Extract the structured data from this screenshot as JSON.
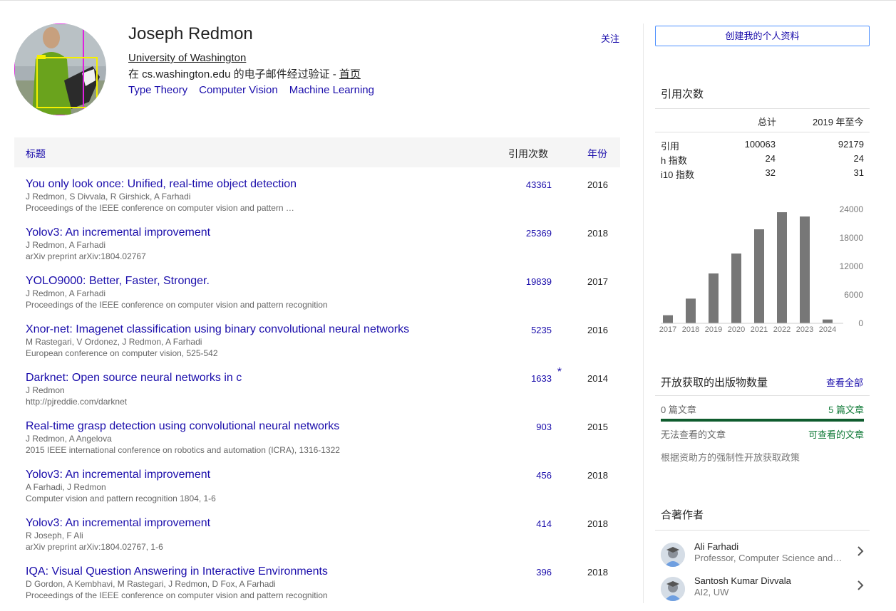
{
  "profile": {
    "name": "Joseph Redmon",
    "affiliation": "University of Washington",
    "verified_prefix": "在 cs.washington.edu 的电子邮件经过验证 - ",
    "homepage": "首页",
    "interests": [
      "Type Theory",
      "Computer Vision",
      "Machine Learning"
    ],
    "follow": "关注"
  },
  "table": {
    "col_title": "标题",
    "col_cites": "引用次数",
    "col_year": "年份",
    "rows": [
      {
        "title": "You only look once: Unified, real-time object detection",
        "authors": "J Redmon, S Divvala, R Girshick, A Farhadi",
        "venue": "Proceedings of the IEEE conference on computer vision and pattern …",
        "cites": "43361",
        "star": "",
        "year": "2016"
      },
      {
        "title": "Yolov3: An incremental improvement",
        "authors": "J Redmon, A Farhadi",
        "venue": "arXiv preprint arXiv:1804.02767",
        "cites": "25369",
        "star": "",
        "year": "2018"
      },
      {
        "title": "YOLO9000: Better, Faster, Stronger.",
        "authors": "J Redmon, A Farhadi",
        "venue": "Proceedings of the IEEE conference on computer vision and pattern recognition",
        "cites": "19839",
        "star": "",
        "year": "2017"
      },
      {
        "title": "Xnor-net: Imagenet classification using binary convolutional neural networks",
        "authors": "M Rastegari, V Ordonez, J Redmon, A Farhadi",
        "venue": "European conference on computer vision, 525-542",
        "cites": "5235",
        "star": "",
        "year": "2016"
      },
      {
        "title": "Darknet: Open source neural networks in c",
        "authors": "J Redmon",
        "venue": "http://pjreddie.com/darknet",
        "cites": "1633",
        "star": "*",
        "year": "2014"
      },
      {
        "title": "Real-time grasp detection using convolutional neural networks",
        "authors": "J Redmon, A Angelova",
        "venue": "2015 IEEE international conference on robotics and automation (ICRA), 1316-1322",
        "cites": "903",
        "star": "",
        "year": "2015"
      },
      {
        "title": "Yolov3: An incremental improvement",
        "authors": "A Farhadi, J Redmon",
        "venue": "Computer vision and pattern recognition 1804, 1-6",
        "cites": "456",
        "star": "",
        "year": "2018"
      },
      {
        "title": "Yolov3: An incremental improvement",
        "authors": "R Joseph, F Ali",
        "venue": "arXiv preprint arXiv:1804.02767, 1-6",
        "cites": "414",
        "star": "",
        "year": "2018"
      },
      {
        "title": "IQA: Visual Question Answering in Interactive Environments",
        "authors": "D Gordon, A Kembhavi, M Rastegari, J Redmon, D Fox, A Farhadi",
        "venue": "Proceedings of the IEEE conference on computer vision and pattern recognition",
        "cites": "396",
        "star": "",
        "year": "2018"
      }
    ]
  },
  "sidebar": {
    "create_button": "创建我的个人资料",
    "cited_by_title": "引用次数",
    "col_total": "总计",
    "col_since": "2019 年至今",
    "stats": [
      {
        "label": "引用",
        "total": "100063",
        "since": "92179"
      },
      {
        "label": "h 指数",
        "total": "24",
        "since": "24"
      },
      {
        "label": "i10 指数",
        "total": "32",
        "since": "31"
      }
    ],
    "oa_title": "开放获取的出版物数量",
    "oa_view_all": "查看全部",
    "oa_unavailable_count": "0 篇文章",
    "oa_available_count": "5 篇文章",
    "oa_unavailable_label": "无法查看的文章",
    "oa_available_label": "可查看的文章",
    "oa_available_fraction": 1.0,
    "oa_policy": "根据资助方的强制性开放获取政策",
    "coauthors_title": "合著作者",
    "coauthors": [
      {
        "name": "Ali Farhadi",
        "affiliation": "Professor, Computer Science and Engineering, University of Washington"
      },
      {
        "name": "Santosh Kumar Divvala",
        "affiliation": "AI2, UW"
      }
    ]
  },
  "chart_data": {
    "type": "bar",
    "categories": [
      "2017",
      "2018",
      "2019",
      "2020",
      "2021",
      "2022",
      "2023",
      "2024"
    ],
    "values": [
      1700,
      5200,
      10500,
      14700,
      19800,
      23400,
      22500,
      800
    ],
    "y_ticks": [
      "24000",
      "18000",
      "12000",
      "6000",
      "0"
    ],
    "ylim": [
      0,
      24000
    ],
    "bar_color": "#777777"
  }
}
